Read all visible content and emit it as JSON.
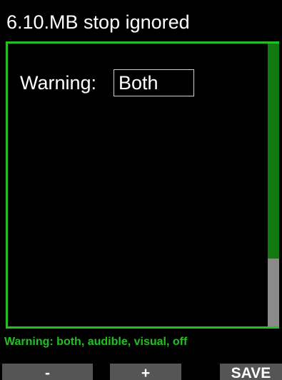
{
  "header": {
    "title": "6.10.MB stop ignored"
  },
  "setting": {
    "label": "Warning:",
    "value": "Both"
  },
  "scrollbar": {
    "position_fraction": 0.0,
    "visible_fraction": 0.76
  },
  "hint": {
    "text": "Warning: both, audible, visual, off"
  },
  "softkeys": {
    "minus_label": "-",
    "plus_label": "+",
    "save_label": "SAVE"
  },
  "colors": {
    "accent": "#22c022",
    "scroll_thumb": "#107a10",
    "scroll_track": "#8a8a8a",
    "softkey_bg": "#555555",
    "background": "#000000"
  }
}
